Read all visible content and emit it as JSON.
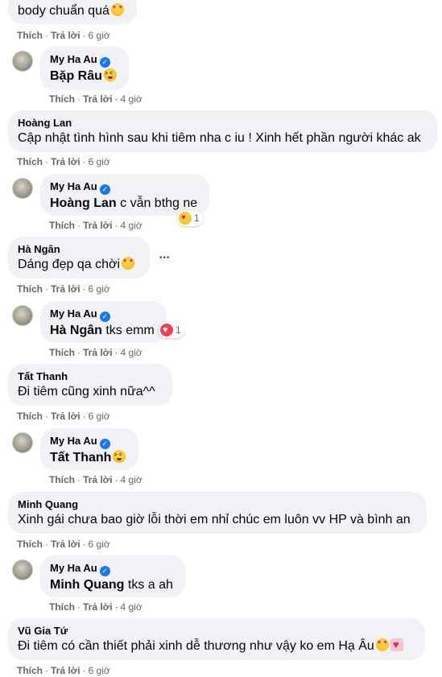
{
  "actions": {
    "like": "Thích",
    "reply": "Trả lời",
    "sep": "·"
  },
  "comments": [
    {
      "type": "top",
      "name": "",
      "text": "body chuẩn quá",
      "emoji": "heart-eyes",
      "time": "6 giờ"
    },
    {
      "type": "reply",
      "name": "My Ha Au",
      "verified": true,
      "mention": "Bặp Râu",
      "text": "",
      "emoji": "squint",
      "time": "4 giờ"
    },
    {
      "type": "top",
      "name": "Hoàng Lan",
      "text": "Cập nhật tình hình sau khi tiêm nha c iu ! Xinh hết phần người khác ak",
      "emoji": "",
      "time": "6 giờ"
    },
    {
      "type": "reply",
      "name": "My Ha Au",
      "verified": true,
      "mention": "Hoàng Lan",
      "text": " c vẫn bthg ne",
      "emoji": "",
      "time": "4 giờ",
      "reaction": {
        "icon": "care-reaction-icon",
        "count": "1"
      }
    },
    {
      "type": "top",
      "name": "Hà Ngân",
      "text": "Dáng đẹp qa chời",
      "emoji": "heart-eyes",
      "time": "6 giờ",
      "more": "•••"
    },
    {
      "type": "reply",
      "name": "My Ha Au",
      "verified": true,
      "mention": "Hà Ngân",
      "text": " tks emm",
      "emoji": "",
      "time": "4 giờ",
      "reaction": {
        "icon": "love-reaction-icon",
        "count": "1"
      }
    },
    {
      "type": "top",
      "name": "Tất Thanh",
      "text": "Đi tiêm cũng xinh nữa^^",
      "emoji": "",
      "time": "6 giờ"
    },
    {
      "type": "reply",
      "name": "My Ha Au",
      "verified": true,
      "mention": "Tất Thanh",
      "text": "",
      "emoji": "squint",
      "time": "4 giờ"
    },
    {
      "type": "top",
      "name": "Minh Quang",
      "text": "Xinh gái chưa bao giờ lỗi thời em nhỉ chúc em luôn vv HP và bình an",
      "emoji": "",
      "time": "6 giờ"
    },
    {
      "type": "reply",
      "name": "My Ha Au",
      "verified": true,
      "mention": "Minh Quang",
      "text": " tks a ah",
      "emoji": "",
      "time": "4 giờ"
    },
    {
      "type": "top",
      "name": "Vũ Gia Tứ",
      "text": "Đi tiêm có cần thiết phải xinh dễ thương như vậy ko em Hạ Âu",
      "emoji": "heart-eyes",
      "emoji2": "heart-box",
      "time": "6 giờ"
    }
  ]
}
